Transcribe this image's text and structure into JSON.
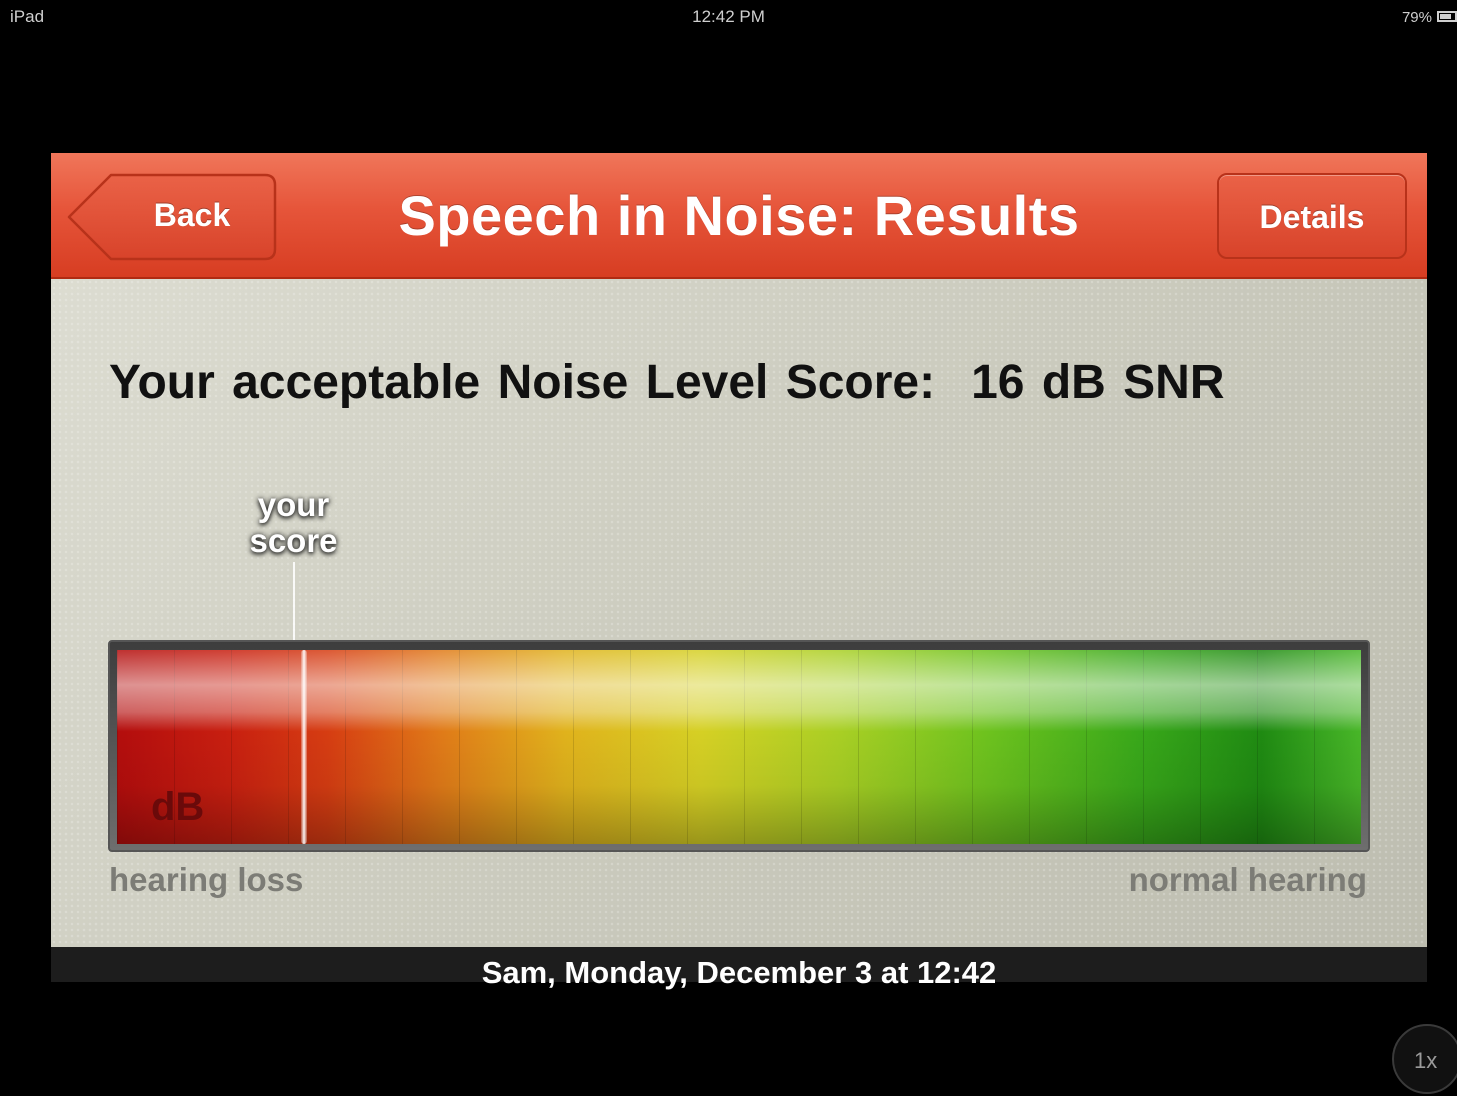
{
  "status_bar": {
    "device": "iPad",
    "time": "12:42 PM",
    "battery": "79%",
    "battery_level": 0.79
  },
  "nav": {
    "back_label": "Back",
    "title": "Speech in Noise: Results",
    "details_label": "Details"
  },
  "result": {
    "score_label": "Your acceptable Noise Level Score:",
    "score_value": "16 dB SNR",
    "marker_label": "your score",
    "marker_position": 0.15,
    "meter_unit": "dB",
    "scale_left": "hearing loss",
    "scale_right": "normal hearing"
  },
  "footer": {
    "text": "Sam, Monday, December 3 at 12:42"
  },
  "zoom": {
    "label": "1x"
  },
  "colors": {
    "nav_top": "#f0765a",
    "nav_bottom": "#d73d22",
    "meter_low": "#b30d0d",
    "meter_mid": "#d5d024",
    "meter_high": "#1f8a12"
  }
}
